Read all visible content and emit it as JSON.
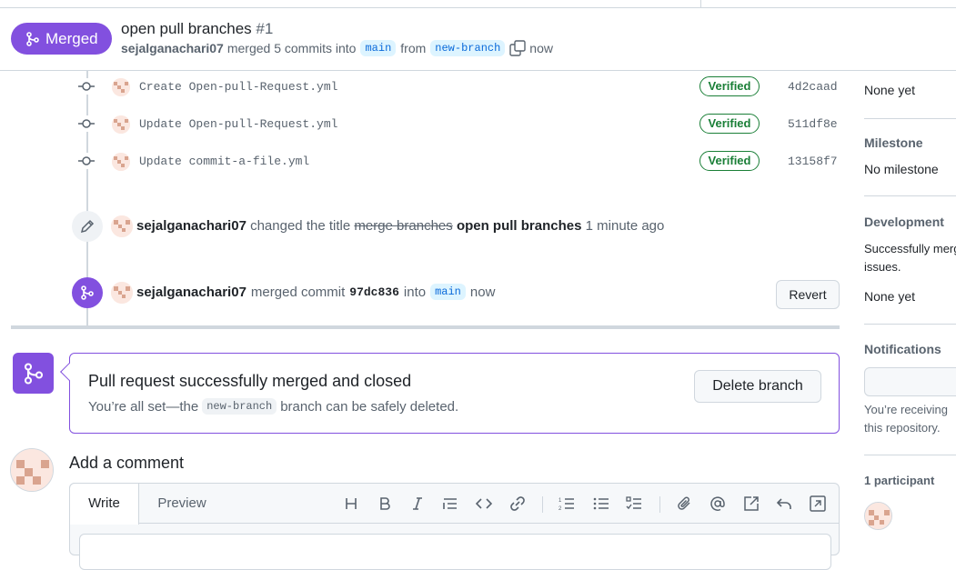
{
  "header": {
    "state": "Merged",
    "title": "open pull branches",
    "number": "#1",
    "author": "sejalganachari07",
    "merged_text": "merged 5 commits into",
    "base_branch": "main",
    "from_text": "from",
    "head_branch": "new-branch",
    "time": "now"
  },
  "commits": [
    {
      "message": "Create Open-pull-Request.yml",
      "badge": "Verified",
      "sha": "4d2caad"
    },
    {
      "message": "Update Open-pull-Request.yml",
      "badge": "Verified",
      "sha": "511df8e"
    },
    {
      "message": "Update commit-a-file.yml",
      "badge": "Verified",
      "sha": "13158f7"
    }
  ],
  "rename_event": {
    "author": "sejalganachari07",
    "action": "changed the title",
    "old_title": "merge branches",
    "new_title": "open pull branches",
    "time": "1 minute ago"
  },
  "merge_event": {
    "author": "sejalganachari07",
    "action": "merged commit",
    "commit": "97dc836",
    "into_text": "into",
    "branch": "main",
    "time": "now",
    "revert_label": "Revert"
  },
  "merged_box": {
    "title": "Pull request successfully merged and closed",
    "sub_prefix": "You’re all set—the",
    "branch": "new-branch",
    "sub_suffix": "branch can be safely deleted.",
    "delete_label": "Delete branch"
  },
  "comment": {
    "heading": "Add a comment",
    "tab_write": "Write",
    "tab_preview": "Preview",
    "toolbar": [
      "heading-icon",
      "bold-icon",
      "italic-icon",
      "quote-icon",
      "code-icon",
      "link-icon",
      "ordered-list-icon",
      "unordered-list-icon",
      "task-list-icon",
      "attach-icon",
      "mention-icon",
      "cross-reference-icon",
      "reply-icon",
      "fullscreen-icon"
    ]
  },
  "sidebar": {
    "linked_value": "None yet",
    "milestone_label": "Milestone",
    "milestone_value": "No milestone",
    "development_label": "Development",
    "development_text_1": "Successfully merg",
    "development_text_2": "issues.",
    "development_value": "None yet",
    "notifications_label": "Notifications",
    "notifications_text_1": "You’re receiving",
    "notifications_text_2": "this repository.",
    "participants_label": "1 participant"
  },
  "colors": {
    "merged_purple": "#8250df",
    "verified_green": "#1a7f37",
    "branch_blue": "#0969da",
    "branch_bg": "#ddf4ff"
  }
}
